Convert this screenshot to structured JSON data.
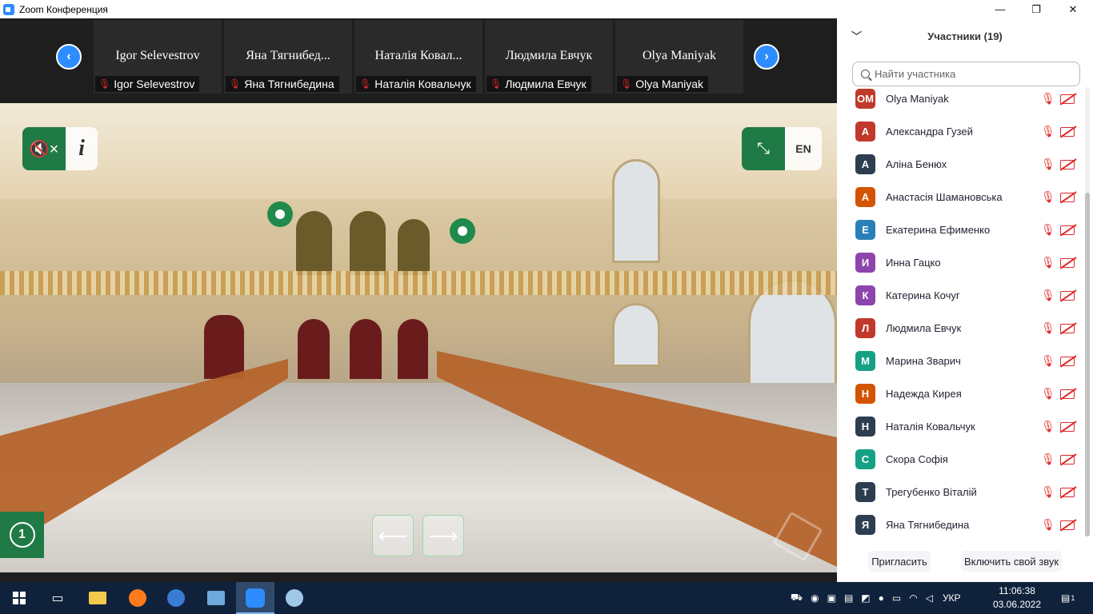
{
  "window": {
    "title": "Zoom Конференция",
    "controls": [
      "—",
      "❐",
      "✕"
    ]
  },
  "strip": {
    "prev_icon": "chevron-left-icon",
    "next_icon": "chevron-right-icon",
    "tiles": [
      {
        "name": "Igor Selevestrov",
        "label": "Igor Selevestrov"
      },
      {
        "name": "Яна  Тягнибед...",
        "label": "Яна Тягнибедина"
      },
      {
        "name": "Наталія Ковал...",
        "label": "Наталія Ковальчук"
      },
      {
        "name": "Людмила Евчук",
        "label": "Людмила Евчук"
      },
      {
        "name": "Olya Maniyak",
        "label": "Olya Maniyak"
      }
    ]
  },
  "video": {
    "mute_icon": "🔇×",
    "info_icon": "i",
    "fullscreen_icon": "⤡",
    "lang": "EN",
    "clock_icon": "1",
    "prev_arrow": "⟵",
    "next_arrow": "⟶"
  },
  "panel": {
    "title": "Участники (19)",
    "search_placeholder": "Найти участника",
    "participants": [
      {
        "initials": "OM",
        "name": "Olya Maniyak",
        "color": "#c0392b"
      },
      {
        "initials": "А",
        "name": "Александра Гузей",
        "color": "#c0392b"
      },
      {
        "initials": "А",
        "name": "Аліна Бенюх",
        "color": "#2c3e50"
      },
      {
        "initials": "А",
        "name": "Анастасія Шамановська",
        "color": "#d35400"
      },
      {
        "initials": "Е",
        "name": "Екатерина Ефименко",
        "color": "#2980b9"
      },
      {
        "initials": "И",
        "name": "Инна Гацко",
        "color": "#8e44ad"
      },
      {
        "initials": "К",
        "name": "Катерина Кочуг",
        "color": "#8e44ad"
      },
      {
        "initials": "Л",
        "name": "Людмила Евчук",
        "color": "#c0392b"
      },
      {
        "initials": "М",
        "name": "Марина Зварич",
        "color": "#16a085"
      },
      {
        "initials": "Н",
        "name": "Надежда Кирея",
        "color": "#d35400"
      },
      {
        "initials": "Н",
        "name": "Наталія Ковальчук",
        "color": "#2c3e50"
      },
      {
        "initials": "С",
        "name": "Скора Софія",
        "color": "#16a085"
      },
      {
        "initials": "Т",
        "name": "Трегубенко Віталій",
        "color": "#2c3e50"
      },
      {
        "initials": "Я",
        "name": "Яна Тягнибедина",
        "color": "#2c3e50"
      }
    ],
    "invite": "Пригласить",
    "unmute": "Включить свой звук"
  },
  "taskbar": {
    "lang": "УКР",
    "time": "11:06:38",
    "date": "03.06.2022",
    "notif_count": "1"
  },
  "colors": {
    "zoom_blue": "#2d8cff",
    "tour_green": "#1f7a45",
    "muted_red": "#e02828",
    "taskbar": "#10223b"
  }
}
